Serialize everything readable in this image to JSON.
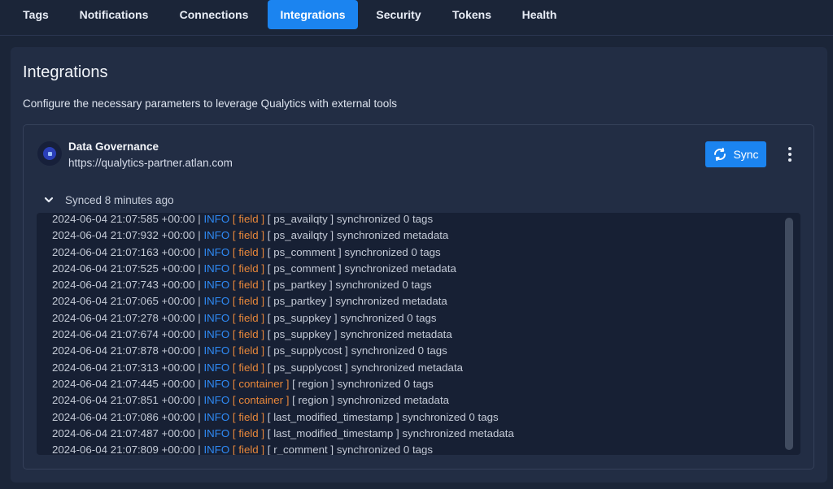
{
  "tabs": [
    {
      "label": "Tags",
      "active": false
    },
    {
      "label": "Notifications",
      "active": false
    },
    {
      "label": "Connections",
      "active": false
    },
    {
      "label": "Integrations",
      "active": true
    },
    {
      "label": "Security",
      "active": false
    },
    {
      "label": "Tokens",
      "active": false
    },
    {
      "label": "Health",
      "active": false
    }
  ],
  "page": {
    "title": "Integrations",
    "subtitle": "Configure the necessary parameters to leverage Qualytics with external tools"
  },
  "integration": {
    "name": "Data Governance",
    "url": "https://qualytics-partner.atlan.com",
    "logo_icon": "atlan-logo-icon",
    "sync_label": "Sync",
    "sync_icon": "sync-icon",
    "menu_icon": "kebab-menu-icon",
    "status": "Synced 8 minutes ago",
    "status_icon": "chevron-down-icon"
  },
  "colors": {
    "accent": "#1b84f0",
    "log_level": "#2f8af5",
    "log_scope": "#e8873a",
    "background": "#1b2538",
    "card": "#222d44",
    "log_background": "#172034"
  },
  "log": [
    {
      "ts": "2024-06-04 21:07:585 +00:00",
      "level": "INFO",
      "scope": "field",
      "object": "ps_availqty",
      "message": "synchronized 0 tags"
    },
    {
      "ts": "2024-06-04 21:07:932 +00:00",
      "level": "INFO",
      "scope": "field",
      "object": "ps_availqty",
      "message": "synchronized metadata"
    },
    {
      "ts": "2024-06-04 21:07:163 +00:00",
      "level": "INFO",
      "scope": "field",
      "object": "ps_comment",
      "message": "synchronized 0 tags"
    },
    {
      "ts": "2024-06-04 21:07:525 +00:00",
      "level": "INFO",
      "scope": "field",
      "object": "ps_comment",
      "message": "synchronized metadata"
    },
    {
      "ts": "2024-06-04 21:07:743 +00:00",
      "level": "INFO",
      "scope": "field",
      "object": "ps_partkey",
      "message": "synchronized 0 tags"
    },
    {
      "ts": "2024-06-04 21:07:065 +00:00",
      "level": "INFO",
      "scope": "field",
      "object": "ps_partkey",
      "message": "synchronized metadata"
    },
    {
      "ts": "2024-06-04 21:07:278 +00:00",
      "level": "INFO",
      "scope": "field",
      "object": "ps_suppkey",
      "message": "synchronized 0 tags"
    },
    {
      "ts": "2024-06-04 21:07:674 +00:00",
      "level": "INFO",
      "scope": "field",
      "object": "ps_suppkey",
      "message": "synchronized metadata"
    },
    {
      "ts": "2024-06-04 21:07:878 +00:00",
      "level": "INFO",
      "scope": "field",
      "object": "ps_supplycost",
      "message": "synchronized 0 tags"
    },
    {
      "ts": "2024-06-04 21:07:313 +00:00",
      "level": "INFO",
      "scope": "field",
      "object": "ps_supplycost",
      "message": "synchronized metadata"
    },
    {
      "ts": "2024-06-04 21:07:445 +00:00",
      "level": "INFO",
      "scope": "container",
      "object": "region",
      "message": "synchronized 0 tags"
    },
    {
      "ts": "2024-06-04 21:07:851 +00:00",
      "level": "INFO",
      "scope": "container",
      "object": "region",
      "message": "synchronized metadata"
    },
    {
      "ts": "2024-06-04 21:07:086 +00:00",
      "level": "INFO",
      "scope": "field",
      "object": "last_modified_timestamp",
      "message": "synchronized 0 tags"
    },
    {
      "ts": "2024-06-04 21:07:487 +00:00",
      "level": "INFO",
      "scope": "field",
      "object": "last_modified_timestamp",
      "message": "synchronized metadata"
    },
    {
      "ts": "2024-06-04 21:07:809 +00:00",
      "level": "INFO",
      "scope": "field",
      "object": "r_comment",
      "message": "synchronized 0 tags"
    }
  ]
}
